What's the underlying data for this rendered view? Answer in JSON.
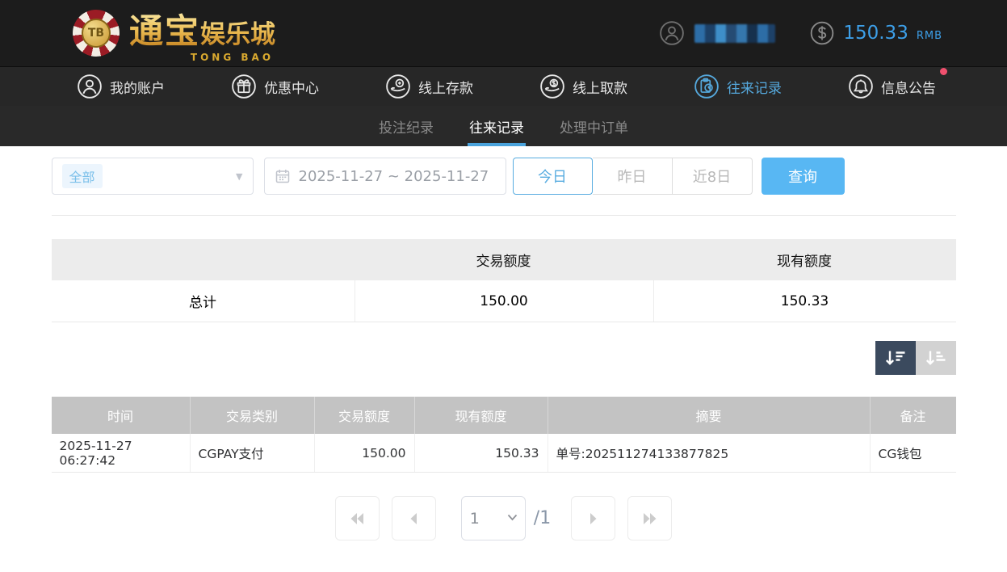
{
  "header": {
    "logo": {
      "chip_label": "TB",
      "title_main": "通宝",
      "title_sub": "娱乐城",
      "subtitle": "TONG BAO"
    },
    "balance": {
      "amount": "150.33",
      "currency": "RMB"
    }
  },
  "nav": {
    "items": [
      {
        "label": "我的账户"
      },
      {
        "label": "优惠中心"
      },
      {
        "label": "线上存款"
      },
      {
        "label": "线上取款"
      },
      {
        "label": "往来记录"
      },
      {
        "label": "信息公告"
      }
    ]
  },
  "subnav": {
    "tabs": [
      {
        "label": "投注纪录"
      },
      {
        "label": "往来记录"
      },
      {
        "label": "处理中订单"
      }
    ]
  },
  "filters": {
    "type_select": {
      "value": "全部"
    },
    "date_range": "2025-11-27 ~ 2025-11-27",
    "periods": [
      {
        "label": "今日"
      },
      {
        "label": "昨日"
      },
      {
        "label": "近8日"
      }
    ],
    "query_label": "查询"
  },
  "summary": {
    "headers": [
      "",
      "交易额度",
      "现有额度"
    ],
    "row": {
      "label": "总计",
      "trade_amount": "150.00",
      "balance": "150.33"
    }
  },
  "table": {
    "headers": [
      "时间",
      "交易类别",
      "交易额度",
      "现有额度",
      "摘要",
      "备注"
    ],
    "rows": [
      {
        "time": "2025-11-27 06:27:42",
        "type": "CGPAY支付",
        "amount": "150.00",
        "balance": "150.33",
        "summary": "单号:202511274133877825",
        "note": "CG钱包"
      }
    ]
  },
  "pagination": {
    "page": "1",
    "total": "/1"
  },
  "colors": {
    "accent": "#55a8dc",
    "query_button": "#58b7f3",
    "notification_dot": "#f0506e",
    "balance_text": "#3d9fe8"
  }
}
